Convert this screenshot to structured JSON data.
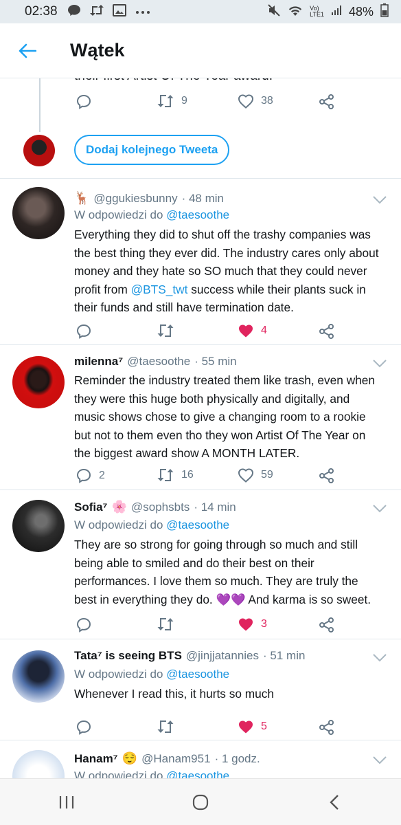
{
  "status_bar": {
    "time": "02:38",
    "network": "LTE1",
    "vo": "Vo)",
    "battery": "48%"
  },
  "header": {
    "title": "Wątek"
  },
  "previous_tweet": {
    "cut_text": "their first Artist Of The Year award.",
    "retweets": "9",
    "likes": "38"
  },
  "reply_button": {
    "label": "Dodaj kolejnego Tweeta"
  },
  "reply_to_label": "W odpowiedzi do",
  "tweets": [
    {
      "name": "",
      "name_emoji": "🦌",
      "handle": "@ggukiesbunny",
      "time": "· 48 min",
      "reply_to": "@taesoothe",
      "lines": [
        "Everything they did to shut off the trashy companies was",
        "the best thing they ever did. The industry cares only about",
        "money and they hate so SO much that they could never",
        "profit from @BTS_twt success while their plants suck in",
        "their funds and still have termination date."
      ],
      "mention": "@BTS_twt",
      "replies": "",
      "retweets": "",
      "likes": "4",
      "liked": true
    },
    {
      "name": "milenna⁷",
      "name_emoji": "",
      "handle": "@taesoothe",
      "time": "· 55 min",
      "reply_to": "",
      "lines": [
        "Reminder the industry treated them like trash, even when",
        "they were this huge both physically and digitally, and",
        "music shows chose to give a changing room to a rookie",
        "but not to them even tho they won Artist Of The Year on",
        "the biggest award show A MONTH LATER."
      ],
      "replies": "2",
      "retweets": "16",
      "likes": "59",
      "liked": false
    },
    {
      "name": "Sofia⁷",
      "name_emoji": "🌸",
      "handle": "@sophsbts",
      "time": "· 14 min",
      "reply_to": "@taesoothe",
      "lines": [
        "They are so strong for going through so much and still",
        "being able to smiled and do their best on their",
        "performances. I love them so much. They are truly the",
        "best in everything they do. 💜💜 And karma is so sweet."
      ],
      "replies": "",
      "retweets": "",
      "likes": "3",
      "liked": true
    },
    {
      "name": "Tata⁷ is seeing BTS",
      "name_emoji": "",
      "handle": "@jinjjatannies",
      "time": "· 51 min",
      "reply_to": "@taesoothe",
      "lines": [
        "Whenever I read this, it hurts so much"
      ],
      "replies": "",
      "retweets": "",
      "likes": "5",
      "liked": true
    },
    {
      "name": "Hanam⁷",
      "name_emoji": "😌",
      "handle": "@Hanam951",
      "time": "· 1 godz.",
      "reply_to": "@taesoothe",
      "lines": [],
      "replies": "",
      "retweets": "",
      "likes": "",
      "liked": false
    }
  ],
  "colors": {
    "accent": "#1da1f2",
    "like": "#e0245e",
    "muted": "#657786"
  }
}
